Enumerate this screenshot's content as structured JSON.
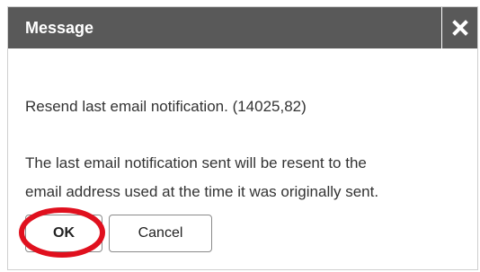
{
  "dialog": {
    "title": "Message",
    "close_icon": "close-icon",
    "lines": [
      "Resend last email notification. (14025,82)",
      "The last email notification sent will be resent to the",
      "email address used at the time it was originally sent."
    ],
    "buttons": {
      "ok_label": "OK",
      "cancel_label": "Cancel"
    },
    "colors": {
      "titlebar": "#595959",
      "highlight": "#e0101e"
    }
  }
}
